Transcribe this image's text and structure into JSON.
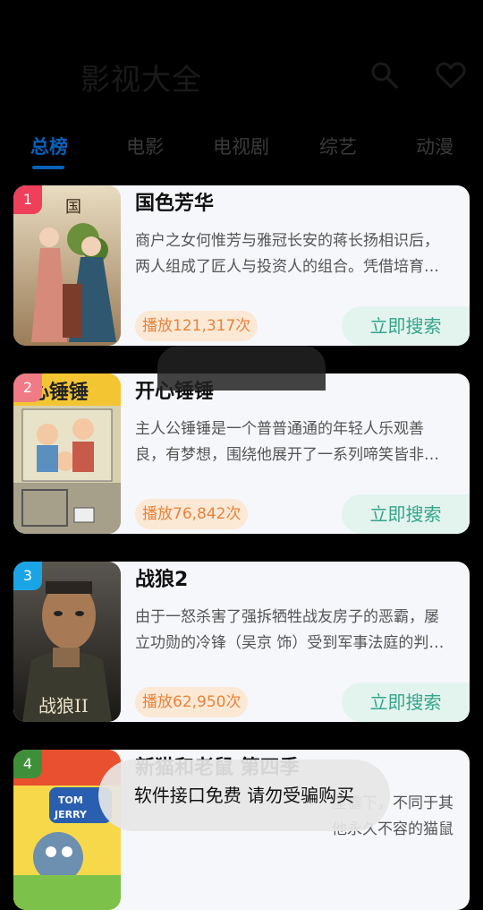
{
  "header": {
    "title": "影视大全",
    "icons": [
      "search-icon",
      "heart-icon"
    ]
  },
  "tabs": [
    {
      "label": "总榜",
      "active": true
    },
    {
      "label": "电影",
      "active": false
    },
    {
      "label": "电视剧",
      "active": false
    },
    {
      "label": "综艺",
      "active": false
    },
    {
      "label": "动漫",
      "active": false
    }
  ],
  "items": [
    {
      "rank": "1",
      "title": "国色芳华",
      "description": "商户之女何惟芳与雅冠长安的蒋长扬相识后，两人组成了匠人与投资人的组合。凭借培育…",
      "plays": "播放121,317次",
      "action": "立即搜索"
    },
    {
      "rank": "2",
      "title": "开心锤锤",
      "description": "主人公锤锤是一个普普通通的年轻人乐观善良，有梦想，围绕他展开了一系列啼笑皆非…",
      "plays": "播放76,842次",
      "action": "立即搜索"
    },
    {
      "rank": "3",
      "title": "战狼2",
      "description": "由于一怒杀害了强拆牺牲战友房子的恶霸，屡立功勋的冷锋（吴京 饰）受到军事法庭的判…",
      "plays": "播放62,950次",
      "action": "立即搜索"
    },
    {
      "rank": "4",
      "title": "新猫和老鼠 第四季",
      "description": "屋檐下，不同于其他永久不容的猫鼠关系，他们更像是一…",
      "plays": "",
      "action": ""
    }
  ],
  "toast": "软件接口免费 请勿受骗购买",
  "colors": {
    "accent": "#0a5fb8",
    "rank1": "#ee3f5b",
    "rank2": "#f07b86",
    "rank3": "#1aa4e6",
    "rank4": "#3f8f3a",
    "play_text": "#e8833a",
    "search_text": "#35a58a"
  }
}
